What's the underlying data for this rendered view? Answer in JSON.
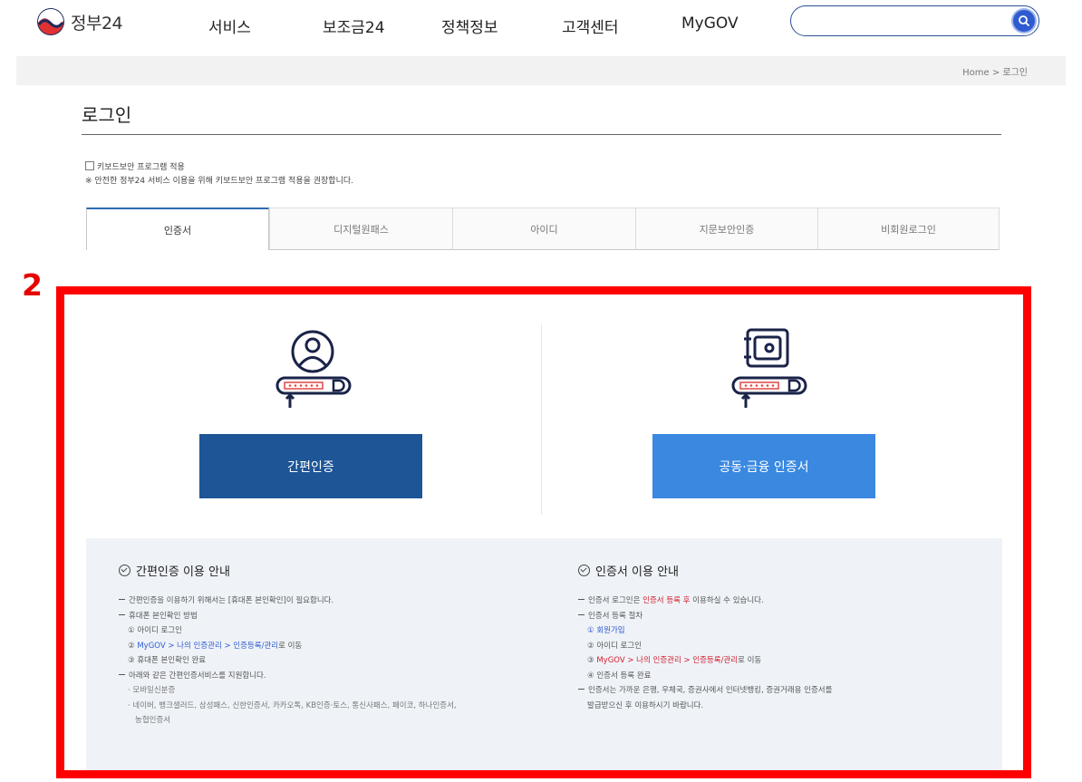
{
  "header": {
    "logo_text": "정부24",
    "nav": [
      "서비스",
      "보조금24",
      "정책정보",
      "고객센터",
      "MyGOV"
    ],
    "search_placeholder": ""
  },
  "breadcrumb": "Home > 로그인",
  "page_title": "로그인",
  "keyboard_security": {
    "label": "키보드보안 프로그램 적용",
    "note": "※ 안전한 정부24 서비스 이용을 위해 키보드보안 프로그램 적용을 권장합니다."
  },
  "tabs": [
    "인증서",
    "디지털원패스",
    "아이디",
    "지문보안인증",
    "비회원로그인"
  ],
  "active_tab": 0,
  "annotation_number": "2",
  "methods": {
    "simple_button": "간편인증",
    "cert_button": "공동·금융 인증서"
  },
  "guide": {
    "simple": {
      "title": "간편인증 이용 안내",
      "line1": "간편인증을 이용하기 위해서는 [휴대폰 본인확인]이 필요합니다.",
      "line2": "휴대폰 본인확인 방법",
      "step1": "① 아이디 로그인",
      "step2_prefix": "② ",
      "step2_link": "MyGOV > 나의 인증관리 > 인증등록/관리",
      "step2_suffix": "로 이동",
      "step3": "③ 휴대폰 본인확인 완료",
      "line3": "아래와 같은 간편인증서비스를 지원합니다.",
      "sub1": "· 모바일신분증",
      "sub2": "· 네이버, 뱅크샐러드, 삼성패스, 신한인증서, 카카오톡, KB인증·토스, 통신사패스, 페이코, 하나인증서,",
      "sub2b": "농협인증서"
    },
    "cert": {
      "title": "인증서 이용 안내",
      "line1_prefix": "인증서 로그인은 ",
      "line1_red": "인증서 등록 후",
      "line1_suffix": " 이용하실 수 있습니다.",
      "line2": "인증서 등록 절차",
      "step1": "① 회원가입",
      "step2": "② 아이디 로그인",
      "step3_prefix": "③ ",
      "step3_link": "MyGOV > 나의 인증관리 > 인증등록/관리",
      "step3_suffix": "로 이동",
      "step4": "④ 인증서 등록 완료",
      "line3": "인증서는 가까운 은행, 우체국, 증권사에서 인터넷뱅킹, 증권거래용 인증서를",
      "line3b": "발급받으신 후 이용하시기 바랍니다."
    }
  },
  "colors": {
    "accent_dark": "#1d5596",
    "accent_light": "#3a88e0",
    "annotation_red": "#ff0000",
    "link_red": "#d21e2c",
    "link_blue": "#2f5bd0"
  }
}
